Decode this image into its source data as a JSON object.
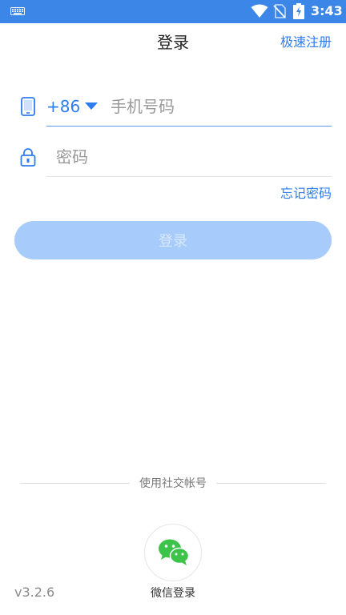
{
  "status_bar": {
    "time": "3:43",
    "icons": [
      "keyboard-icon",
      "wifi-icon",
      "no-sim-icon",
      "battery-charging-icon"
    ],
    "color": "#3b86e6"
  },
  "header": {
    "title": "登录",
    "register_link": "极速注册"
  },
  "phone_field": {
    "icon": "phone-icon",
    "country_code": "+86",
    "value": "",
    "placeholder": "手机号码"
  },
  "password_field": {
    "icon": "lock-icon",
    "value": "",
    "placeholder": "密码"
  },
  "forgot_password": "忘记密码",
  "login_button": {
    "label": "登录",
    "state": "disabled",
    "color": "#a7cbfb"
  },
  "social": {
    "divider_text": "使用社交帐号",
    "wechat_label": "微信登录",
    "wechat_icon": "wechat-icon",
    "wechat_color": "#3cc34a"
  },
  "version": "v3.2.6",
  "accent_color": "#2d7cf0"
}
